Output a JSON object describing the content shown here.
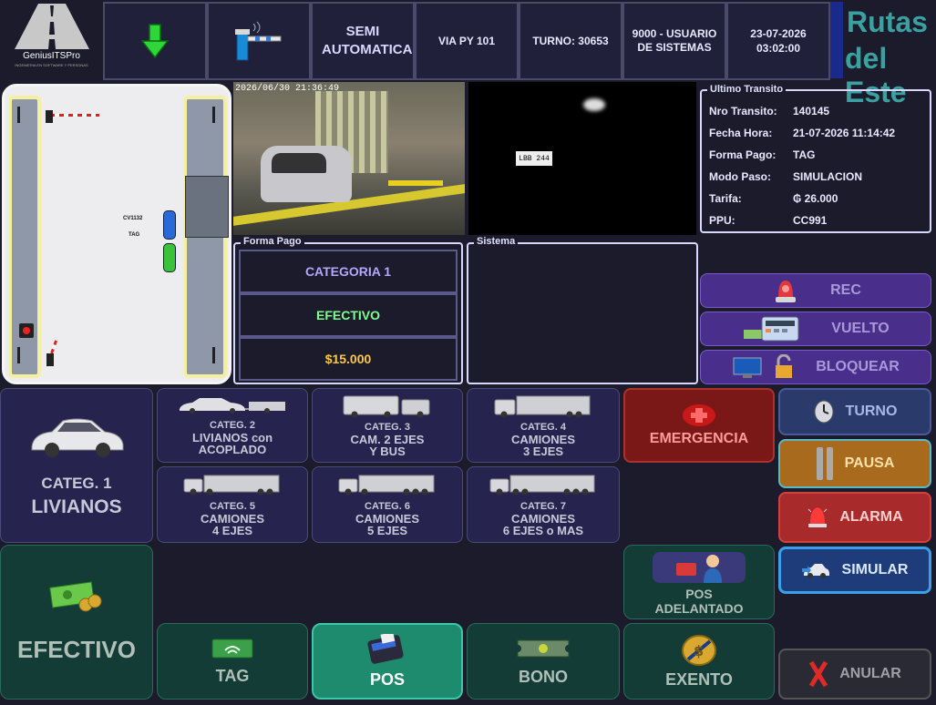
{
  "header": {
    "logo_text": "GeniusITSPro",
    "logo_subtext": "INGENIERIA EN SOFTWARE Y PERSONAS",
    "mode": "SEMI AUTOMATICA",
    "via": "VIA PY 101",
    "turno": "TURNO: 30653",
    "usuario": "9000 - USUARIO DE SISTEMAS",
    "fecha": "23-07-2026",
    "hora": "03:02:00",
    "brand_line1": "Rutas",
    "brand_line2": "del Este"
  },
  "lane": {
    "vehicle_id": "CV1132",
    "tag_label": "TAG"
  },
  "camera1": {
    "overlay": "2026/06/30 21:36:49"
  },
  "camera2": {
    "plate": "LBB 244"
  },
  "ultimo_transito": {
    "title": "Ultimo Transito",
    "rows": [
      {
        "k": "Nro Transito:",
        "v": "140145"
      },
      {
        "k": "Fecha Hora:",
        "v": "21-07-2026 11:14:42"
      },
      {
        "k": "Forma Pago:",
        "v": "TAG"
      },
      {
        "k": "Modo Paso:",
        "v": "SIMULACION"
      },
      {
        "k": "Tarifa:",
        "v": "₲ 26.000"
      },
      {
        "k": "PPU:",
        "v": "CC991"
      }
    ]
  },
  "forma_pago": {
    "title": "Forma Pago",
    "categoria": "CATEGORIA 1",
    "medio": "EFECTIVO",
    "monto": "$15.000"
  },
  "sistema": {
    "title": "Sistema"
  },
  "actions": {
    "rec": "REC",
    "vuelto": "VUELTO",
    "bloquear": "BLOQUEAR"
  },
  "categories": {
    "c1": {
      "l1": "CATEG. 1",
      "l2": "LIVIANOS"
    },
    "c2": {
      "l1": "CATEG. 2",
      "l2": "LIVIANOS con",
      "l3": "ACOPLADO"
    },
    "c3": {
      "l1": "CATEG. 3",
      "l2": "CAM. 2 EJES",
      "l3": "Y BUS"
    },
    "c4": {
      "l1": "CATEG. 4",
      "l2": "CAMIONES",
      "l3": "3 EJES"
    },
    "c5": {
      "l1": "CATEG. 5",
      "l2": "CAMIONES",
      "l3": "4 EJES"
    },
    "c6": {
      "l1": "CATEG. 6",
      "l2": "CAMIONES",
      "l3": "5 EJES"
    },
    "c7": {
      "l1": "CATEG. 7",
      "l2": "CAMIONES",
      "l3": "6 EJES o MAS"
    }
  },
  "side": {
    "emergencia": "EMERGENCIA",
    "turno": "TURNO",
    "pausa": "PAUSA",
    "alarma": "ALARMA",
    "simular": "SIMULAR",
    "anular": "ANULAR"
  },
  "payments": {
    "efectivo": "EFECTIVO",
    "tag": "TAG",
    "pos": "POS",
    "bono": "BONO",
    "exento": "EXENTO",
    "pos_adelantado_l1": "POS",
    "pos_adelantado_l2": "ADELANTADO"
  },
  "colors": {
    "background": "#1b1b2b",
    "category_bg": "#26244e",
    "payment_bg": "#123c35",
    "pos_active": "#1e8a6e",
    "emergency": "#7a1818",
    "pausa": "#a86a1c",
    "alarma": "#a82a2a",
    "turno": "#2a3a6a",
    "simular": "#1e3c7a",
    "amount": "#ffc83a",
    "medio": "#7cff8c",
    "category_text": "#b5a5ff"
  }
}
